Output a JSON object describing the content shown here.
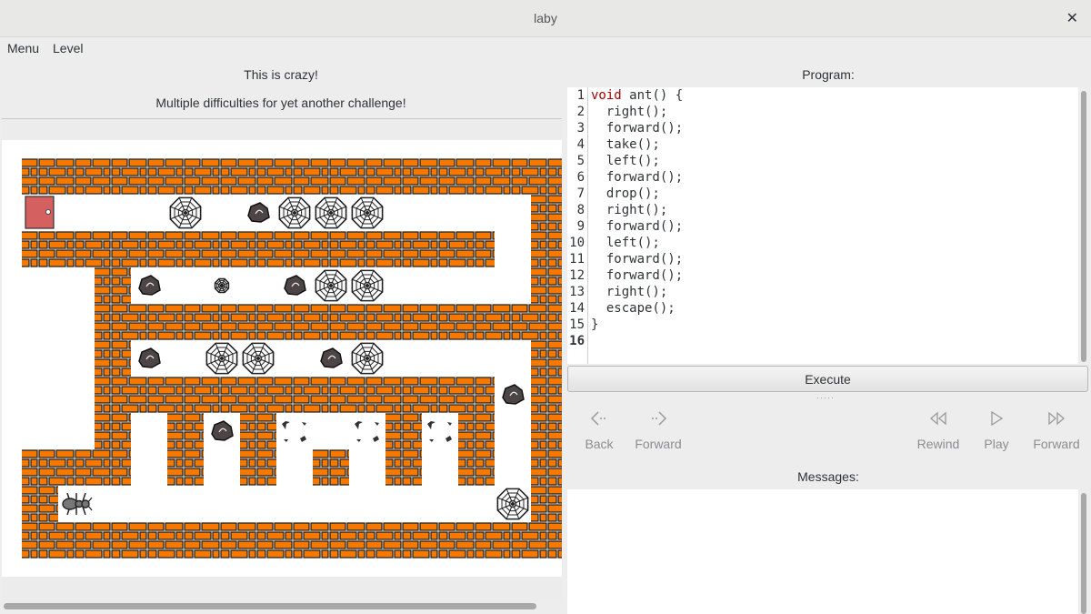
{
  "window": {
    "title": "laby"
  },
  "menubar": {
    "items": [
      "Menu",
      "Level"
    ]
  },
  "level": {
    "title": "This is crazy!",
    "description": "Multiple difficulties for yet another challenge!"
  },
  "program": {
    "label": "Program:",
    "lines": [
      "void ant() {",
      "  right();",
      "  forward();",
      "  take();",
      "  left();",
      "  forward();",
      "  drop();",
      "  right();",
      "  forward();",
      "  left();",
      "  forward();",
      "  forward();",
      "  right();",
      "  escape();",
      "}",
      ""
    ],
    "current_line": 16
  },
  "execute_label": "Execute",
  "history": {
    "back": "Back",
    "forward": "Forward"
  },
  "playback": {
    "rewind": "Rewind",
    "play": "Play",
    "forward": "Forward"
  },
  "messages": {
    "label": "Messages:",
    "text": ""
  },
  "colors": {
    "wall": "#f57900",
    "door": "#d46060",
    "keyword": "#a40000"
  },
  "maze": {
    "legend": {
      "#": "wall",
      ".": "floor",
      "D": "exit-door",
      "A": "ant",
      "W": "spider-web",
      "w": "small-web",
      "R": "rock",
      "P": "pit"
    },
    "rows": [
      "###############",
      "D...W.RWWW....#",
      "#############.#",
      "..#R.w.RWW....#",
      "..#############",
      "..#R.WW.RW....#",
      "..###########R#",
      "..#.#R#P.P#P#.#",
      "###.#.#.#.#.#.#",
      "#A...........W#",
      "###############"
    ]
  }
}
